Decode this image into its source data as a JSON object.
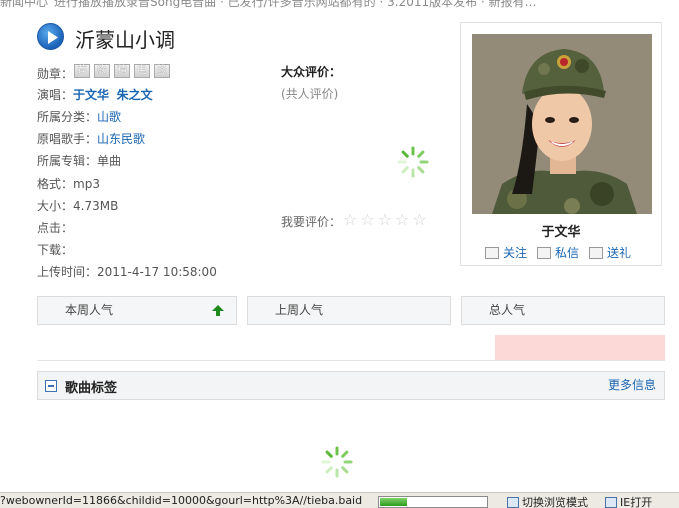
{
  "top_strip_text": "新闻中心_进行播放播放录音Song电音曲 · 已发行/许多音乐网站都有的 · 3.2011版本发布 · 新报有…",
  "song": {
    "title": "沂蒙山小调"
  },
  "info": {
    "medal_label": "勋章：",
    "medals": [
      "荐",
      "緣",
      "精",
      "电",
      "签"
    ],
    "singer_label": "演唱：",
    "singers": [
      "于文华",
      "朱之文"
    ],
    "category_label": "所属分类：",
    "category": "山歌",
    "original_label": "原唱歌手：",
    "original": "山东民歌",
    "album_label": "所属专辑：",
    "album": "单曲",
    "format_label": "格式：",
    "format": "mp3",
    "size_label": "大小：",
    "size": "4.73MB",
    "clicks_label": "点击：",
    "downloads_label": "下载：",
    "upload_label": "上传时间：",
    "upload_time": "2011-4-17 10:58:00"
  },
  "rating": {
    "title": "大众评价：",
    "count_text": "(共人评价)",
    "my_rating_label": "我要评价：",
    "stars": 5
  },
  "artist": {
    "name": "于文华",
    "actions": [
      "关注",
      "私信",
      "送礼"
    ]
  },
  "popularity": {
    "tabs": [
      "本周人气",
      "上周人气",
      "总人气"
    ]
  },
  "tags": {
    "title": "歌曲标签",
    "more": "更多信息"
  },
  "statusbar": {
    "url": "?webownerId=11866&childid=10000&gourl=http%3A//tieba.baid",
    "progress": 0.25,
    "switch_mode": "切换浏览模式",
    "open_label": "IE打开"
  },
  "colors": {
    "link": "#1a66b3",
    "pink": "#fcd9d6",
    "green_arrow": "#1e8a1e"
  }
}
